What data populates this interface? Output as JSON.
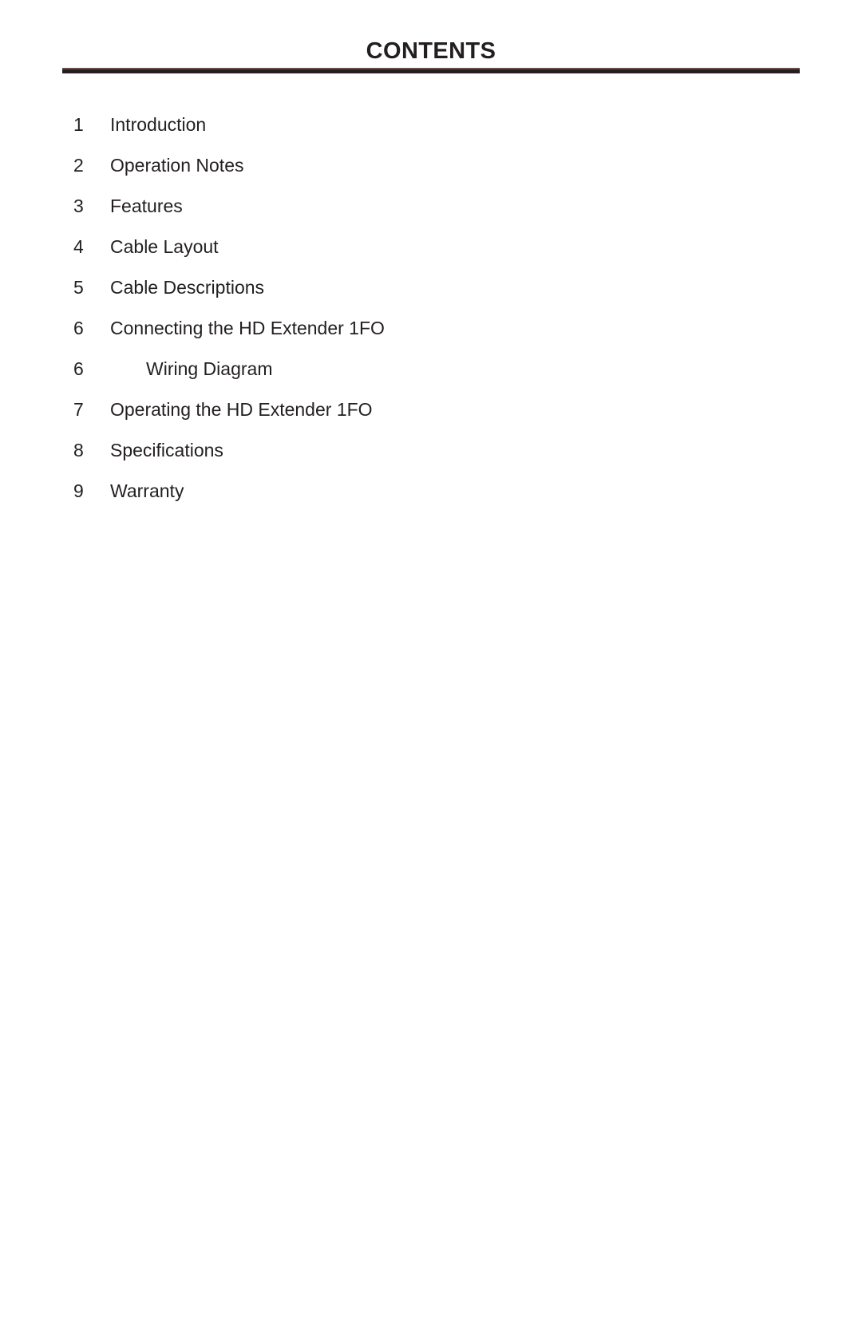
{
  "document": {
    "title": "CONTENTS",
    "background_color": "#ffffff",
    "text_color": "#231f20",
    "rule_color": "#231f20",
    "rule_accent_color": "#6b4a4a"
  },
  "contents": {
    "entries": [
      {
        "page": "1",
        "label": "Introduction",
        "level": 1
      },
      {
        "page": "2",
        "label": "Operation Notes",
        "level": 1
      },
      {
        "page": "3",
        "label": "Features",
        "level": 1
      },
      {
        "page": "4",
        "label": "Cable Layout",
        "level": 1
      },
      {
        "page": "5",
        "label": "Cable Descriptions",
        "level": 1
      },
      {
        "page": "6",
        "label": "Connecting the HD Extender 1FO",
        "level": 1
      },
      {
        "page": "6",
        "label": "Wiring Diagram",
        "level": 2
      },
      {
        "page": "7",
        "label": "Operating the HD Extender 1FO",
        "level": 1
      },
      {
        "page": "8",
        "label": "Specifications",
        "level": 1
      },
      {
        "page": "9",
        "label": "Warranty",
        "level": 1
      }
    ]
  }
}
